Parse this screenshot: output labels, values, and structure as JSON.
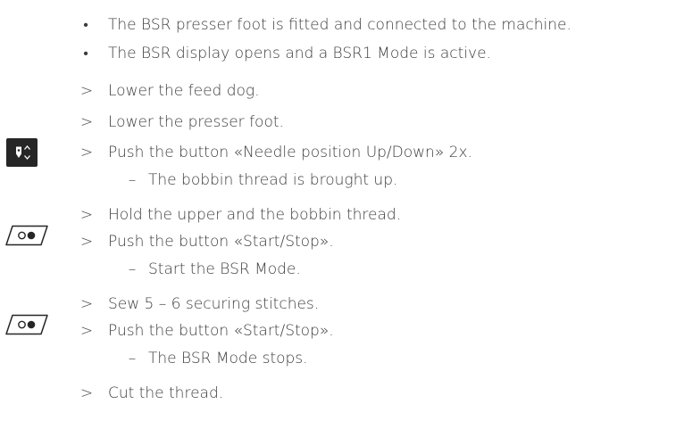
{
  "bullets": [
    {
      "marker": "•",
      "text": "The BSR presser foot is fitted and connected to the machine."
    },
    {
      "marker": "•",
      "text": "The BSR display opens and a BSR1 Mode is active."
    }
  ],
  "steps": [
    {
      "marker": ">",
      "text": "Lower the feed dog."
    },
    {
      "marker": ">",
      "text": "Lower the presser foot."
    },
    {
      "marker": ">",
      "text": "Push the button «Needle position Up/Down» 2x."
    },
    {
      "marker": "–",
      "text": "The bobbin thread is brought up."
    },
    {
      "marker": ">",
      "text": "Hold the upper and the bobbin thread."
    },
    {
      "marker": ">",
      "text": "Push the button «Start/Stop»."
    },
    {
      "marker": "–",
      "text": "Start the BSR Mode."
    },
    {
      "marker": ">",
      "text": "Sew 5 – 6 securing stitches."
    },
    {
      "marker": ">",
      "text": "Push the button «Start/Stop»."
    },
    {
      "marker": "–",
      "text": "The BSR Mode stops."
    },
    {
      "marker": ">",
      "text": "Cut the thread."
    }
  ],
  "icons": {
    "needle": "needle-position-up-down-icon",
    "start_stop": "start-stop-icon"
  },
  "colors": {
    "text": "#3c3c3c",
    "icon_dark": "#262626"
  }
}
